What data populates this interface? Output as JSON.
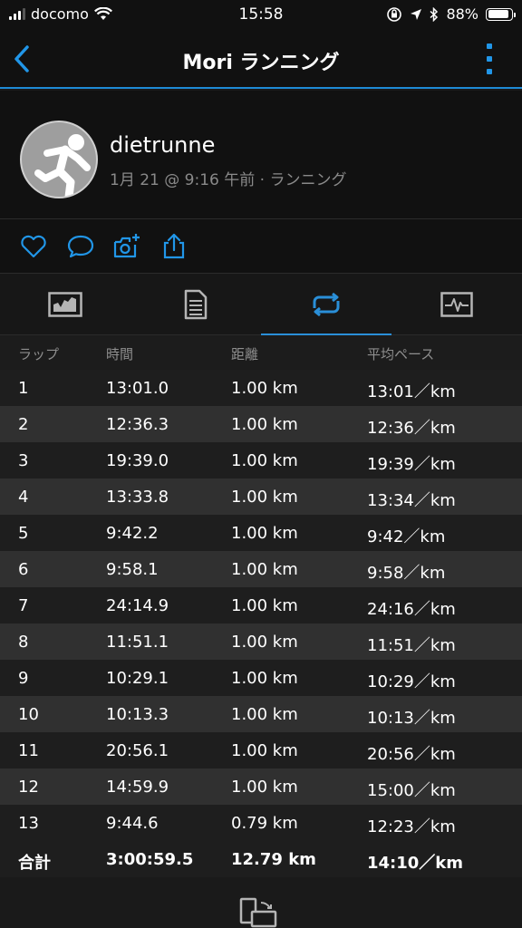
{
  "status_bar": {
    "carrier": "docomo",
    "time": "15:58",
    "battery_text": "88%",
    "battery_level": 0.88
  },
  "nav": {
    "title": "Mori ランニング"
  },
  "profile": {
    "username": "dietrunne",
    "meta": "1月 21 @ 9:16 午前 · ランニング"
  },
  "tabs": [
    "chart-tab",
    "details-tab",
    "laps-tab",
    "stats-tab"
  ],
  "laps_table": {
    "headers": [
      "ラップ",
      "時間",
      "距離",
      "平均ペース"
    ],
    "rows": [
      [
        "1",
        "13:01.0",
        "1.00 km",
        "13:01／km"
      ],
      [
        "2",
        "12:36.3",
        "1.00 km",
        "12:36／km"
      ],
      [
        "3",
        "19:39.0",
        "1.00 km",
        "19:39／km"
      ],
      [
        "4",
        "13:33.8",
        "1.00 km",
        "13:34／km"
      ],
      [
        "5",
        "9:42.2",
        "1.00 km",
        "9:42／km"
      ],
      [
        "6",
        "9:58.1",
        "1.00 km",
        "9:58／km"
      ],
      [
        "7",
        "24:14.9",
        "1.00 km",
        "24:16／km"
      ],
      [
        "8",
        "11:51.1",
        "1.00 km",
        "11:51／km"
      ],
      [
        "9",
        "10:29.1",
        "1.00 km",
        "10:29／km"
      ],
      [
        "10",
        "10:13.3",
        "1.00 km",
        "10:13／km"
      ],
      [
        "11",
        "20:56.1",
        "1.00 km",
        "20:56／km"
      ],
      [
        "12",
        "14:59.9",
        "1.00 km",
        "15:00／km"
      ],
      [
        "13",
        "9:44.6",
        "0.79 km",
        "12:23／km"
      ]
    ],
    "total": [
      "合計",
      "3:00:59.5",
      "12.79 km",
      "14:10／km"
    ]
  },
  "colors": {
    "accent": "#2196e8",
    "background": "#1a1a1a",
    "row_alt": "#303030"
  }
}
